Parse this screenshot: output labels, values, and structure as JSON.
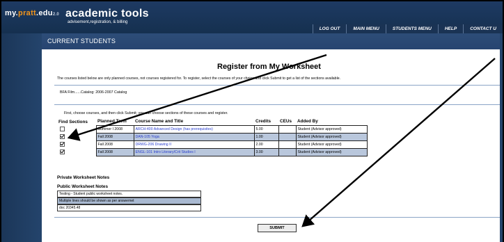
{
  "header": {
    "brand": {
      "my": "my.",
      "pratt": "pratt",
      "edu": ".edu",
      "version": "2.0"
    },
    "app_title": "academic tools",
    "app_subtitle": "advisement,registration, & billing",
    "nav": [
      "LOG OUT",
      "MAIN MENU",
      "STUDENTS MENU",
      "HELP",
      "CONTACT U"
    ]
  },
  "section_title": "CURRENT STUDENTS",
  "page": {
    "heading": "Register from My Worksheet",
    "intro": "The courses listed below are only planned courses, not courses registered for. To register, select the courses of your choice and click Submit to get a list of the sections available.",
    "catalog": "BFA Film......Catalog: 2006-2007 Catalog",
    "instructions": "First, choose courses, and then click Submit; you can choose sections of these courses and register."
  },
  "table": {
    "headers": [
      "Find Sections",
      "Planned Term",
      "Course Name and Title",
      "Credits",
      "CEUs",
      "Added By"
    ],
    "rows": [
      {
        "checked": false,
        "term": "Summer I 2008",
        "course": "ARCH-400 Advanced Design (has prerequisites)",
        "credits": "5.00",
        "ceus": "",
        "added_by": "Student (Advisor approved)"
      },
      {
        "checked": true,
        "term": "Fall 2008",
        "course": "DAN-105 Yoga",
        "credits": "1.00",
        "ceus": "",
        "added_by": "Student (Advisor approved)"
      },
      {
        "checked": true,
        "term": "Fall 2008",
        "course": "DRWG-206 Drawing II",
        "credits": "2.00",
        "ceus": "",
        "added_by": "Student (Advisor approved)"
      },
      {
        "checked": true,
        "term": "Fall 2008",
        "course": "ENGL-101 Intro Literary/Crit Studies I",
        "credits": "3.00",
        "ceus": "",
        "added_by": "Student (Advisor approved)"
      }
    ]
  },
  "notes": {
    "private_heading": "Private Worksheet Notes",
    "public_heading": "Public Worksheet Notes",
    "public_lines": [
      "Testing - Student public worksheet notes.",
      "Multiple lines should be shown as per answernet",
      "doc 20345.48"
    ]
  },
  "submit_label": "SUBMIT",
  "colors": {
    "header": "#1e3a63",
    "accent": "#f0941c",
    "selected_row": "#b9c7dc",
    "link": "#2a3fcf"
  }
}
